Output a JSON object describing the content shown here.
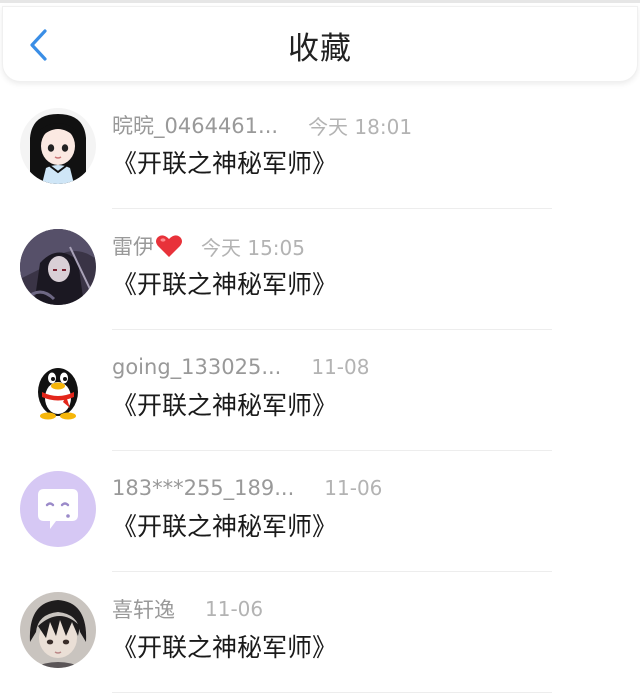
{
  "header": {
    "title": "收藏",
    "back_icon": "chevron-left-icon",
    "accent_color": "#3a8ee6"
  },
  "favorites": [
    {
      "name": "晥晥_0464461...",
      "time": "今天 18:01",
      "content": "《开联之神秘军师》",
      "avatar": "anime-girl-avatar"
    },
    {
      "name": "雷伊",
      "time": "今天 15:05",
      "content": "《开联之神秘军师》",
      "avatar": "dark-character-avatar",
      "badge": "red-heart-icon"
    },
    {
      "name": "going_133025...",
      "time": "11-08",
      "content": "《开联之神秘军师》",
      "avatar": "qq-penguin-avatar"
    },
    {
      "name": "183***255_189...",
      "time": "11-06",
      "content": "《开联之神秘军师》",
      "avatar": "chat-bubble-avatar"
    },
    {
      "name": "喜轩逸",
      "time": "11-06",
      "content": "《开联之神秘军师》",
      "avatar": "anime-boy-avatar"
    }
  ]
}
